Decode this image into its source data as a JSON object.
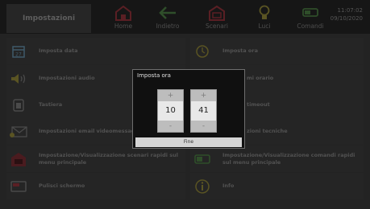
{
  "header": {
    "title": "Impostazioni",
    "nav": [
      {
        "label": "Home",
        "icon": "home-icon"
      },
      {
        "label": "Indietro",
        "icon": "back-arrow-icon"
      },
      {
        "label": "Scenari",
        "icon": "scenarios-icon"
      },
      {
        "label": "Luci",
        "icon": "bulb-icon"
      },
      {
        "label": "Comandi",
        "icon": "commands-icon"
      }
    ],
    "time": "11:07:02",
    "date": "09/10/2020"
  },
  "settings": {
    "left": [
      {
        "label": "Imposta data",
        "icon": "calendar-icon"
      },
      {
        "label": "Impostazioni audio",
        "icon": "speaker-icon"
      },
      {
        "label": "Tastiera",
        "icon": "keypad-icon"
      },
      {
        "label": "Impostazioni email videomessaggi",
        "icon": "envelope-icon"
      },
      {
        "label": "Impostazione/Visualizzazione scenari rapidi sul menu principale",
        "icon": "scenarios-icon"
      },
      {
        "label": "Pulisci schermo",
        "icon": "screen-icon"
      }
    ],
    "right": [
      {
        "label": "Imposta ora",
        "icon": "clock-icon"
      },
      {
        "label": "mi orario",
        "icon": "none"
      },
      {
        "label": "timeout",
        "icon": "none"
      },
      {
        "label": "zioni tecniche",
        "icon": "none"
      },
      {
        "label": "Impostazione/Visualizzazione comandi rapidi sul menu principale",
        "icon": "commands-icon"
      },
      {
        "label": "Info",
        "icon": "info-icon"
      }
    ]
  },
  "dialog": {
    "title": "Imposta ora",
    "hours": "10",
    "minutes": "41",
    "increment_symbol": "+",
    "decrement_symbol": "-",
    "confirm_label": "Fine"
  },
  "colors": {
    "icon_red": "#5a1f24",
    "icon_green": "#2f4e2a",
    "icon_olive": "#5a5423",
    "icon_gray": "#4a4a4a"
  }
}
